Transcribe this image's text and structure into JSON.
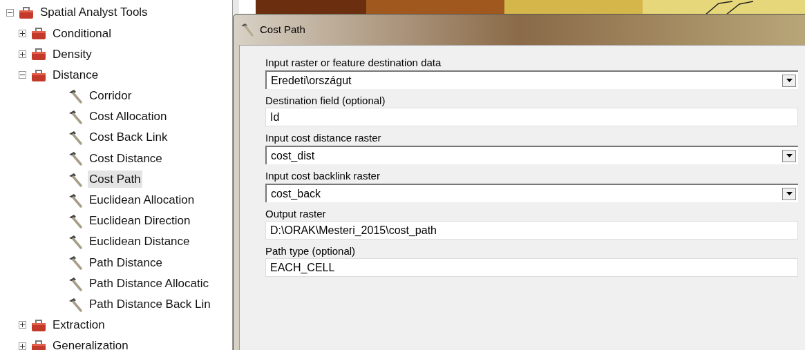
{
  "tree": [
    {
      "kind": "toolbox",
      "label": "Spatial Analyst Tools",
      "expanded": true,
      "children": [
        {
          "kind": "toolset",
          "label": "Conditional",
          "expanded": false
        },
        {
          "kind": "toolset",
          "label": "Density",
          "expanded": false
        },
        {
          "kind": "toolset",
          "label": "Distance",
          "expanded": true,
          "children": [
            {
              "kind": "tool",
              "label": "Corridor",
              "selected": false
            },
            {
              "kind": "tool",
              "label": "Cost Allocation",
              "selected": false
            },
            {
              "kind": "tool",
              "label": "Cost Back Link",
              "selected": false
            },
            {
              "kind": "tool",
              "label": "Cost Distance",
              "selected": false
            },
            {
              "kind": "tool",
              "label": "Cost Path",
              "selected": true
            },
            {
              "kind": "tool",
              "label": "Euclidean Allocation",
              "selected": false
            },
            {
              "kind": "tool",
              "label": "Euclidean Direction",
              "selected": false
            },
            {
              "kind": "tool",
              "label": "Euclidean Distance",
              "selected": false
            },
            {
              "kind": "tool",
              "label": "Path Distance",
              "selected": false
            },
            {
              "kind": "tool",
              "label": "Path Distance Allocatic",
              "selected": false
            },
            {
              "kind": "tool",
              "label": "Path Distance Back Lin",
              "selected": false
            }
          ]
        },
        {
          "kind": "toolset",
          "label": "Extraction",
          "expanded": false
        },
        {
          "kind": "toolset",
          "label": "Generalization",
          "expanded": false
        }
      ]
    }
  ],
  "dialog": {
    "title": "Cost Path",
    "parameters": [
      {
        "label": "Input raster or feature destination data",
        "kind": "dropdown",
        "value": "Eredeti\\országut"
      },
      {
        "label": "Destination field (optional)",
        "kind": "text",
        "value": "Id"
      },
      {
        "label": "Input cost distance raster",
        "kind": "dropdown",
        "value": "cost_dist"
      },
      {
        "label": "Input cost backlink raster",
        "kind": "dropdown",
        "value": "cost_back"
      },
      {
        "label": "Output raster",
        "kind": "text",
        "value": "D:\\ORAK\\Mesteri_2015\\cost_path"
      },
      {
        "label": "Path type (optional)",
        "kind": "text",
        "value": "EACH_CELL"
      }
    ]
  }
}
